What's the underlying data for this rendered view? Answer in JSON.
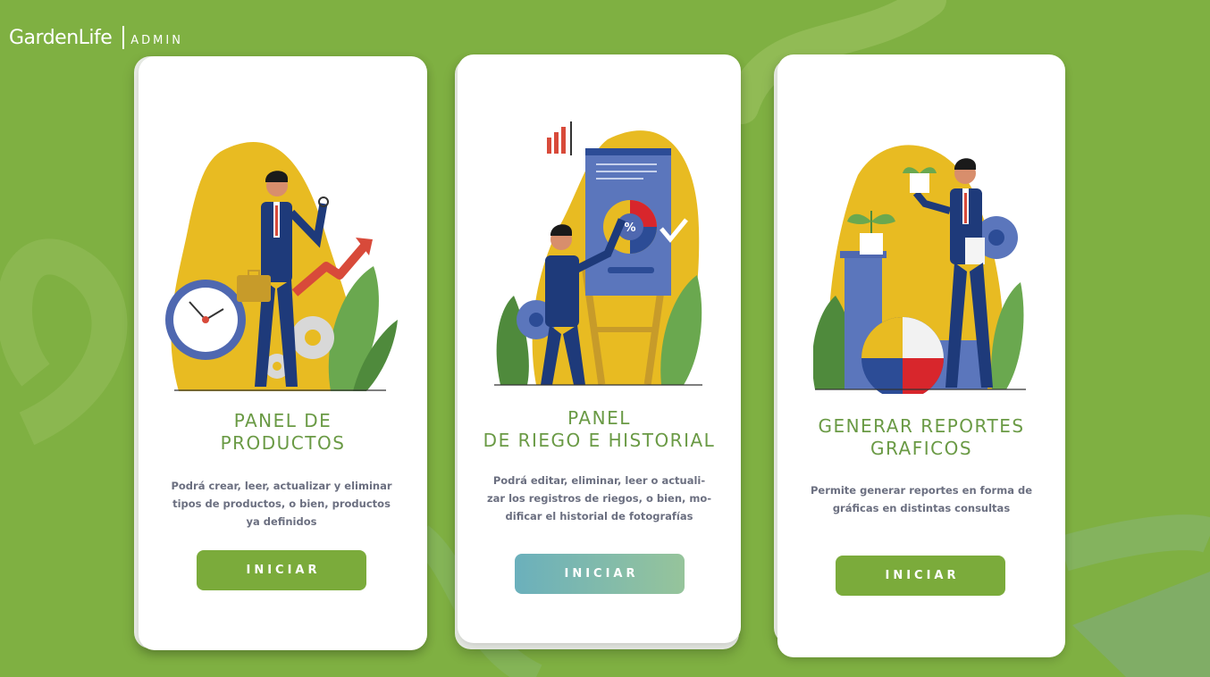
{
  "brand": {
    "name": "GardenLife",
    "section": "ADMIN"
  },
  "cards": [
    {
      "title_lines": [
        "PANEL DE",
        "PRODUCTOS"
      ],
      "description_lines": [
        "Podrá crear, leer, actualizar y eliminar",
        "tipos de productos, o bien, productos",
        "ya definidos"
      ],
      "button_label": "INICIAR"
    },
    {
      "title_lines": [
        "PANEL",
        "DE RIEGO E HISTORIAL"
      ],
      "description_lines": [
        "Podrá editar, eliminar, leer o actuali-",
        "zar los registros de riegos, o bien, mo-",
        "dificar el historial de fotografías"
      ],
      "button_label": "INICIAR"
    },
    {
      "title_lines": [
        "GENERAR REPORTES",
        "GRAFICOS"
      ],
      "description_lines": [
        "Permite generar reportes en forma de",
        "gráficas en distintas consultas"
      ],
      "button_label": "INICIAR"
    }
  ],
  "colors": {
    "background": "#7fb042",
    "title": "#6a9a45",
    "button": "#7bab3b",
    "button_gradient_start": "#6bb0bc",
    "button_gradient_end": "#96c49b",
    "illustration_yellow": "#e8bb22",
    "suit_blue": "#1e3a7a"
  },
  "icons": [
    "briefcase-businessman-illustration",
    "presentation-board-illustration",
    "plant-report-illustration"
  ]
}
